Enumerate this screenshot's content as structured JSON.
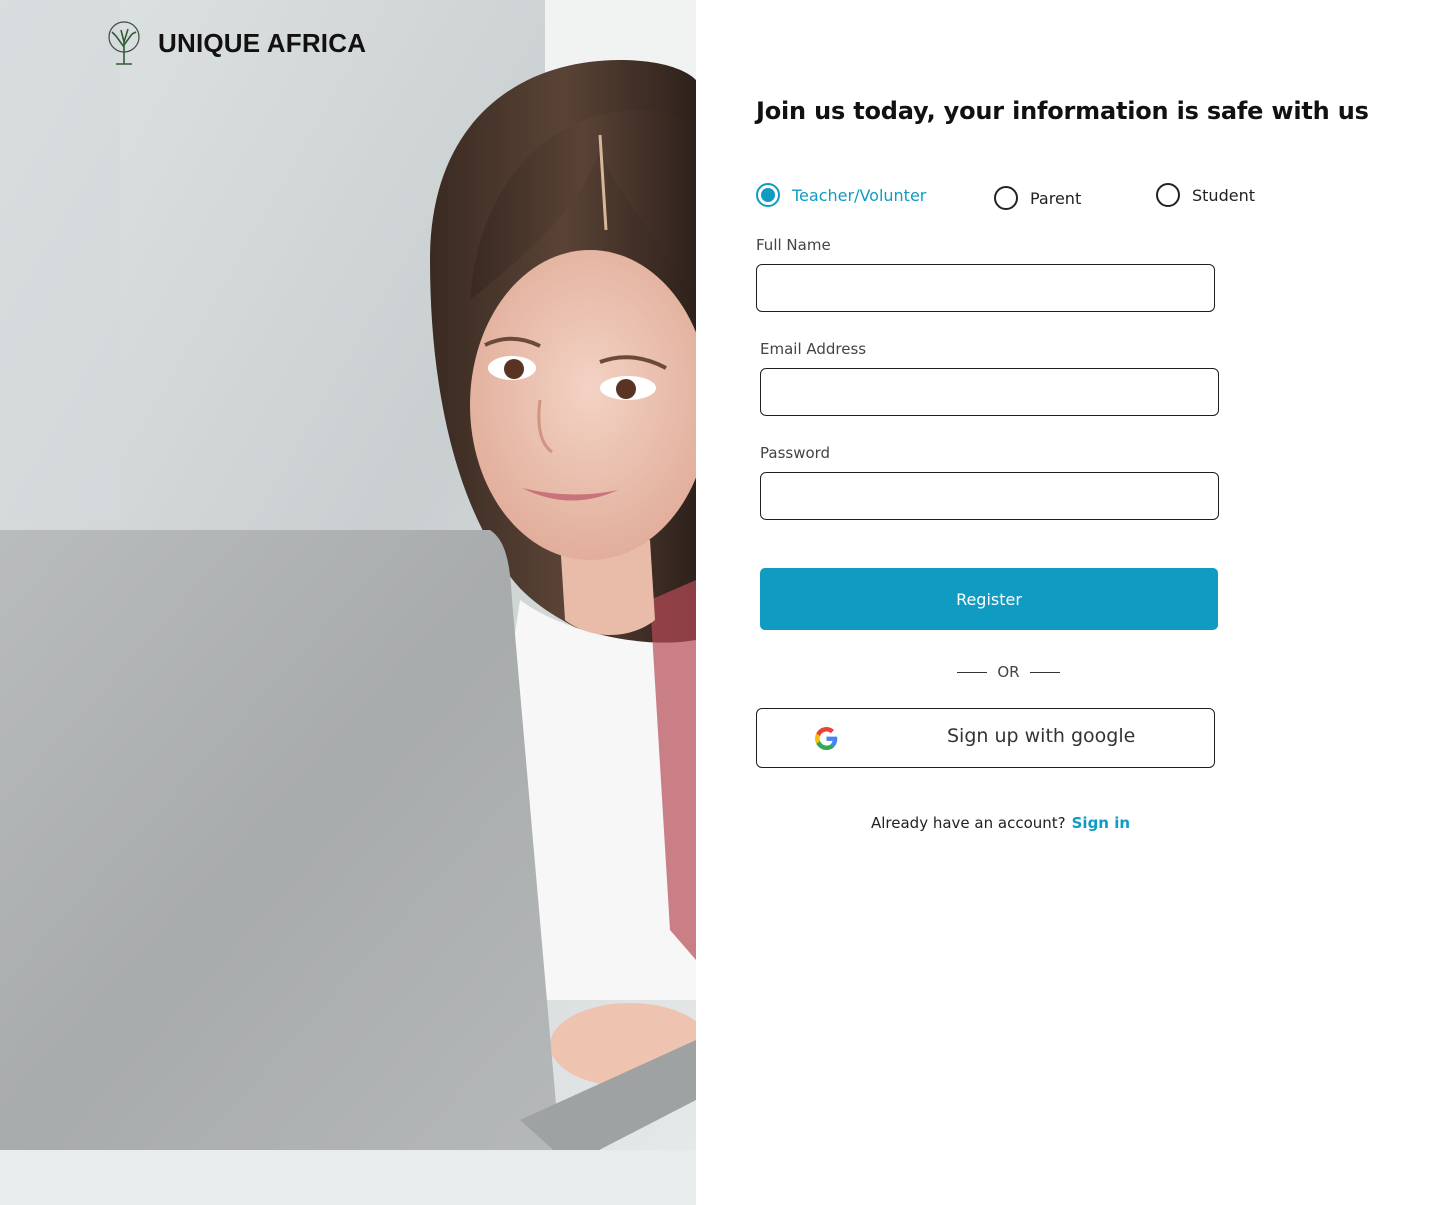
{
  "brand": {
    "name": "UNIQUE AFRICA",
    "logo_icon": "tree-icon"
  },
  "hero": {
    "image_subject": "girl-using-laptop-photo"
  },
  "form": {
    "title": "Join us today, your information is safe with us",
    "roles": [
      {
        "label": "Teacher/Volunter",
        "selected": true
      },
      {
        "label": "Parent",
        "selected": false
      },
      {
        "label": "Student",
        "selected": false
      }
    ],
    "fields": {
      "full_name": {
        "label": "Full Name",
        "value": ""
      },
      "email": {
        "label": "Email Address",
        "value": ""
      },
      "password": {
        "label": "Password",
        "value": ""
      }
    },
    "register_label": "Register",
    "divider_text": "OR",
    "google": {
      "label": "Sign up with google",
      "icon": "google-icon"
    },
    "signin": {
      "prompt": "Already have an account?",
      "link": "Sign in"
    }
  },
  "colors": {
    "accent": "#0f9bc2",
    "border": "#1f1f1f",
    "text": "#111111"
  }
}
